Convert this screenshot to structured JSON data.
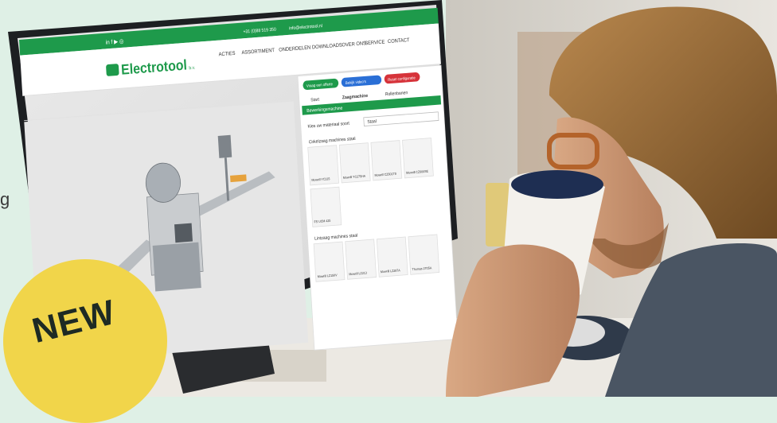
{
  "badge": {
    "label": "NEW"
  },
  "left_fragment": "g",
  "website": {
    "brand": "Electrotool",
    "brand_suffix": "b.v.",
    "social": "in  f  ▶  ◎",
    "topbar_phone": "+31 (0)88 519 350",
    "topbar_email": "info@electrotool.nl",
    "nav": [
      "ACTIES",
      "ASSORTIMENT",
      "ONDERDELEN",
      "DOWNLOADS",
      "OVER ONS",
      "SERVICE",
      "CONTACT"
    ],
    "panel": {
      "btn_quote": "Vraag een offerte",
      "btn_video": "Bekijk video's",
      "btn_reset": "Reset configuratie",
      "steps": [
        "Start",
        "Zaagmachine",
        "Rollenbanen"
      ],
      "section_header": "Bewerkingsmachine",
      "material_label": "Kies uw materiaal soort",
      "material_value": "Staal",
      "group1_title": "Cirkelzaag machines staal",
      "group1_items": [
        "Mowrill YC315",
        "Mowrill YC275HA",
        "Mowrill CZ601TS",
        "Mowrill CZ600SE"
      ],
      "group1_extra": "FS UCM 425",
      "group2_title": "Lintzaag machines staal",
      "group2_items": [
        "Mowrill LZ150V",
        "Mowrill LZ213",
        "Mowrill LZ287A",
        "Thomas 270SA"
      ]
    }
  },
  "colors": {
    "background": "#dff0e6",
    "brand_green": "#1e9a4b",
    "badge_yellow": "#f1d54a",
    "badge_text": "#1e2a24"
  }
}
